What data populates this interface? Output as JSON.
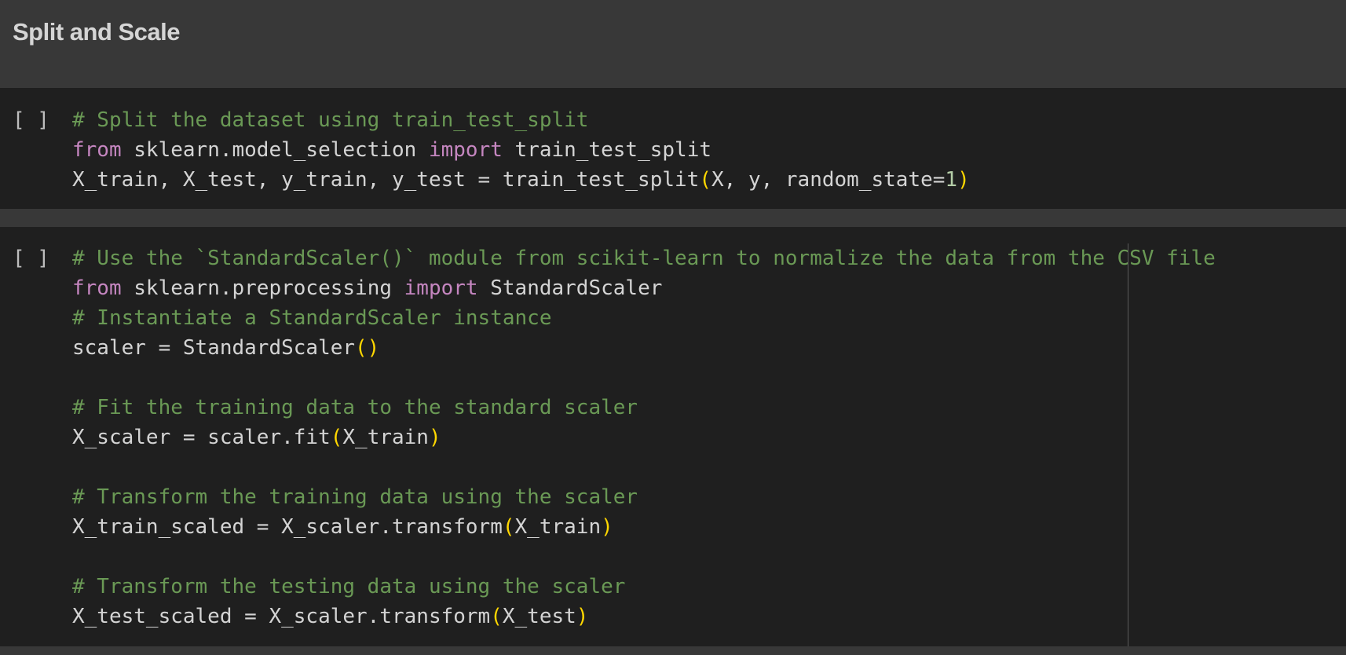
{
  "heading": {
    "title": "Split and Scale"
  },
  "cells": [
    {
      "run_indicator": "[ ]",
      "lines": [
        {
          "tokens": [
            {
              "t": "# Split the dataset using train_test_split",
              "k": "comment"
            }
          ]
        },
        {
          "tokens": [
            {
              "t": "from",
              "k": "keyword"
            },
            {
              "t": " sklearn.model_selection ",
              "k": "plain"
            },
            {
              "t": "import",
              "k": "keyword"
            },
            {
              "t": " train_test_split",
              "k": "plain"
            }
          ]
        },
        {
          "tokens": [
            {
              "t": "X_train, X_test, y_train, y_test = train_test_split",
              "k": "plain"
            },
            {
              "t": "(",
              "k": "paren"
            },
            {
              "t": "X, y, random_state=",
              "k": "plain"
            },
            {
              "t": "1",
              "k": "number"
            },
            {
              "t": ")",
              "k": "paren"
            }
          ]
        }
      ]
    },
    {
      "run_indicator": "[ ]",
      "lines": [
        {
          "tokens": [
            {
              "t": "# Use the `StandardScaler()` module from scikit-learn to normalize the data from the CSV file",
              "k": "comment"
            }
          ]
        },
        {
          "tokens": [
            {
              "t": "from",
              "k": "keyword"
            },
            {
              "t": " sklearn.preprocessing ",
              "k": "plain"
            },
            {
              "t": "import",
              "k": "keyword"
            },
            {
              "t": " StandardScaler",
              "k": "plain"
            }
          ]
        },
        {
          "tokens": [
            {
              "t": "# Instantiate a StandardScaler instance",
              "k": "comment"
            }
          ]
        },
        {
          "tokens": [
            {
              "t": "scaler = StandardScaler",
              "k": "plain"
            },
            {
              "t": "()",
              "k": "paren"
            }
          ]
        },
        {
          "tokens": []
        },
        {
          "tokens": [
            {
              "t": "# Fit the training data to the standard scaler",
              "k": "comment"
            }
          ]
        },
        {
          "tokens": [
            {
              "t": "X_scaler = scaler.fit",
              "k": "plain"
            },
            {
              "t": "(",
              "k": "paren"
            },
            {
              "t": "X_train",
              "k": "plain"
            },
            {
              "t": ")",
              "k": "paren"
            }
          ]
        },
        {
          "tokens": []
        },
        {
          "tokens": [
            {
              "t": "# Transform the training data using the scaler",
              "k": "comment"
            }
          ]
        },
        {
          "tokens": [
            {
              "t": "X_train_scaled = X_scaler.transform",
              "k": "plain"
            },
            {
              "t": "(",
              "k": "paren"
            },
            {
              "t": "X_train",
              "k": "plain"
            },
            {
              "t": ")",
              "k": "paren"
            }
          ]
        },
        {
          "tokens": []
        },
        {
          "tokens": [
            {
              "t": "# Transform the testing data using the scaler",
              "k": "comment"
            }
          ]
        },
        {
          "tokens": [
            {
              "t": "X_test_scaled = X_scaler.transform",
              "k": "plain"
            },
            {
              "t": "(",
              "k": "paren"
            },
            {
              "t": "X_test",
              "k": "plain"
            },
            {
              "t": ")",
              "k": "paren"
            }
          ]
        }
      ]
    }
  ],
  "colors": {
    "background": "#383838",
    "cell_background": "#1f1f1f",
    "comment": "#6a9955",
    "keyword": "#c586c0",
    "paren": "#ffd700",
    "text": "#d4d4d4"
  }
}
